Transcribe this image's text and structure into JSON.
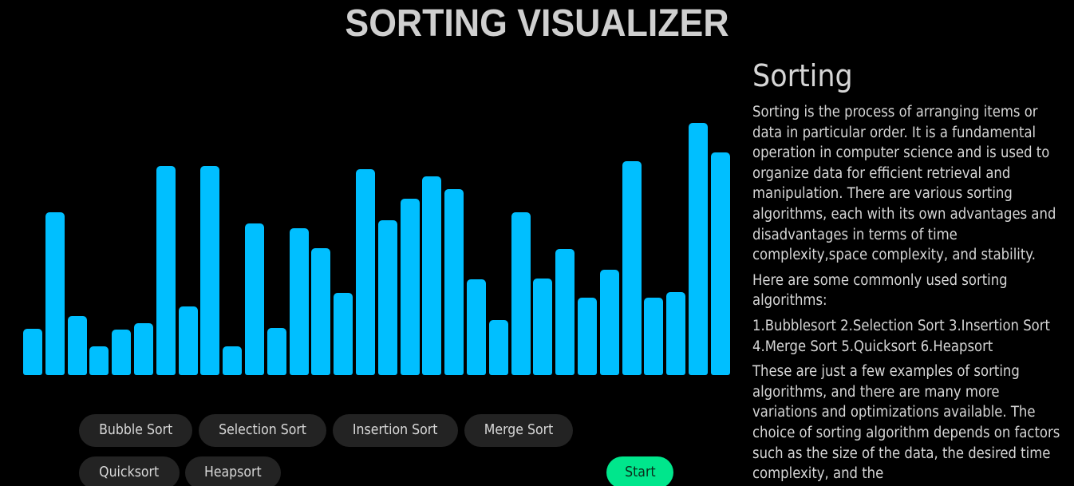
{
  "header": {
    "title": "SORTING VISUALIZER"
  },
  "bars": {
    "color": "#00bfff",
    "values": [
      58,
      204,
      74,
      36,
      57,
      65,
      262,
      86,
      262,
      36,
      190,
      59,
      184,
      159,
      103,
      258,
      194,
      221,
      249,
      233,
      120,
      69,
      204,
      121,
      158,
      97,
      132,
      268,
      97,
      104,
      316,
      279
    ]
  },
  "algorithms": {
    "buttons": [
      {
        "label": "Bubble Sort"
      },
      {
        "label": "Selection Sort"
      },
      {
        "label": "Insertion Sort"
      },
      {
        "label": "Merge Sort"
      },
      {
        "label": "Quicksort"
      },
      {
        "label": "Heapsort"
      }
    ],
    "start_label": "Start",
    "start_color": "#00e68c"
  },
  "info": {
    "heading": "Sorting",
    "paragraph1": "Sorting is the process of arranging items or data in particular order. It is a fundamental operation in computer science and is used to organize data for efficient retrieval and manipulation. There are various sorting algorithms, each with its own advantages and disadvantages in terms of time complexity,space complexity, and stability.",
    "paragraph2": "Here are some commonly used sorting algorithms:",
    "paragraph3": "1.Bubblesort 2.Selection Sort 3.Insertion Sort 4.Merge Sort 5.Quicksort 6.Heapsort",
    "paragraph4": "These are just a few examples of sorting algorithms, and there are many more variations and optimizations available. The choice of sorting algorithm depends on factors such as the size of the data, the desired time complexity, and the"
  }
}
